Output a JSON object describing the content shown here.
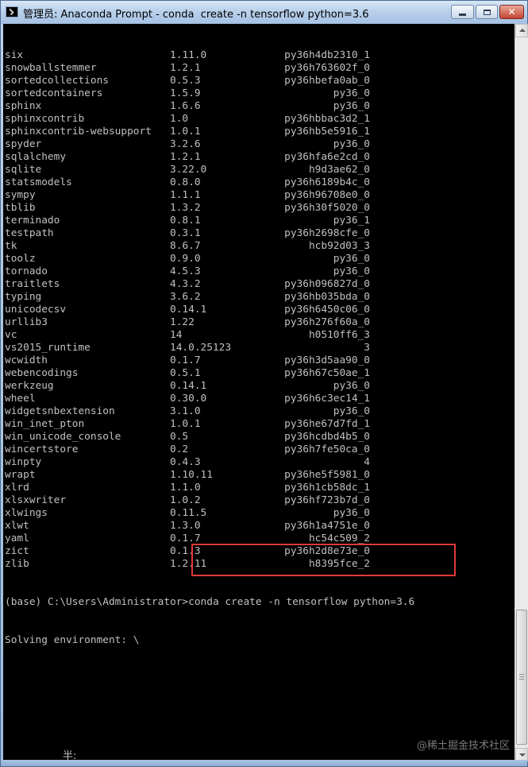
{
  "window": {
    "title": "管理员: Anaconda Prompt - conda  create -n tensorflow python=3.6",
    "icon": "terminal-icon",
    "buttons": {
      "minimize": "minimize-icon",
      "maximize": "maximize-icon",
      "close": "✕"
    }
  },
  "console": {
    "packages": [
      [
        "six",
        "1.11.0",
        "py36h4db2310_1"
      ],
      [
        "snowballstemmer",
        "1.2.1",
        "py36h763602f_0"
      ],
      [
        "sortedcollections",
        "0.5.3",
        "py36hbefa0ab_0"
      ],
      [
        "sortedcontainers",
        "1.5.9",
        "py36_0"
      ],
      [
        "sphinx",
        "1.6.6",
        "py36_0"
      ],
      [
        "sphinxcontrib",
        "1.0",
        "py36hbbac3d2_1"
      ],
      [
        "sphinxcontrib-websupport",
        "1.0.1",
        "py36hb5e5916_1"
      ],
      [
        "spyder",
        "3.2.6",
        "py36_0"
      ],
      [
        "sqlalchemy",
        "1.2.1",
        "py36hfa6e2cd_0"
      ],
      [
        "sqlite",
        "3.22.0",
        "h9d3ae62_0"
      ],
      [
        "statsmodels",
        "0.8.0",
        "py36h6189b4c_0"
      ],
      [
        "sympy",
        "1.1.1",
        "py36h96708e0_0"
      ],
      [
        "tblib",
        "1.3.2",
        "py36h30f5020_0"
      ],
      [
        "terminado",
        "0.8.1",
        "py36_1"
      ],
      [
        "testpath",
        "0.3.1",
        "py36h2698cfe_0"
      ],
      [
        "tk",
        "8.6.7",
        "hcb92d03_3"
      ],
      [
        "toolz",
        "0.9.0",
        "py36_0"
      ],
      [
        "tornado",
        "4.5.3",
        "py36_0"
      ],
      [
        "traitlets",
        "4.3.2",
        "py36h096827d_0"
      ],
      [
        "typing",
        "3.6.2",
        "py36hb035bda_0"
      ],
      [
        "unicodecsv",
        "0.14.1",
        "py36h6450c06_0"
      ],
      [
        "urllib3",
        "1.22",
        "py36h276f60a_0"
      ],
      [
        "vc",
        "14",
        "h0510ff6_3"
      ],
      [
        "vs2015_runtime",
        "14.0.25123",
        "3"
      ],
      [
        "wcwidth",
        "0.1.7",
        "py36h3d5aa90_0"
      ],
      [
        "webencodings",
        "0.5.1",
        "py36h67c50ae_1"
      ],
      [
        "werkzeug",
        "0.14.1",
        "py36_0"
      ],
      [
        "wheel",
        "0.30.0",
        "py36h6c3ec14_1"
      ],
      [
        "widgetsnbextension",
        "3.1.0",
        "py36_0"
      ],
      [
        "win_inet_pton",
        "1.0.1",
        "py36he67d7fd_1"
      ],
      [
        "win_unicode_console",
        "0.5",
        "py36hcdbd4b5_0"
      ],
      [
        "wincertstore",
        "0.2",
        "py36h7fe50ca_0"
      ],
      [
        "winpty",
        "0.4.3",
        "4"
      ],
      [
        "wrapt",
        "1.10.11",
        "py36he5f5981_0"
      ],
      [
        "xlrd",
        "1.1.0",
        "py36h1cb58dc_1"
      ],
      [
        "xlsxwriter",
        "1.0.2",
        "py36hf723b7d_0"
      ],
      [
        "xlwings",
        "0.11.5",
        "py36_0"
      ],
      [
        "xlwt",
        "1.3.0",
        "py36h1a4751e_0"
      ],
      [
        "yaml",
        "0.1.7",
        "hc54c509_2"
      ],
      [
        "zict",
        "0.1.3",
        "py36h2d8e73e_0"
      ],
      [
        "zlib",
        "1.2.11",
        "h8395fce_2"
      ]
    ],
    "prompt": "(base) C:\\Users\\Administrator>",
    "command": "conda create -n tensorflow python=3.6",
    "status": "Solving environment: \\",
    "ime_indicator": "半:",
    "highlight_color": "#e03a3a"
  },
  "watermark": "@稀土掘金技术社区"
}
